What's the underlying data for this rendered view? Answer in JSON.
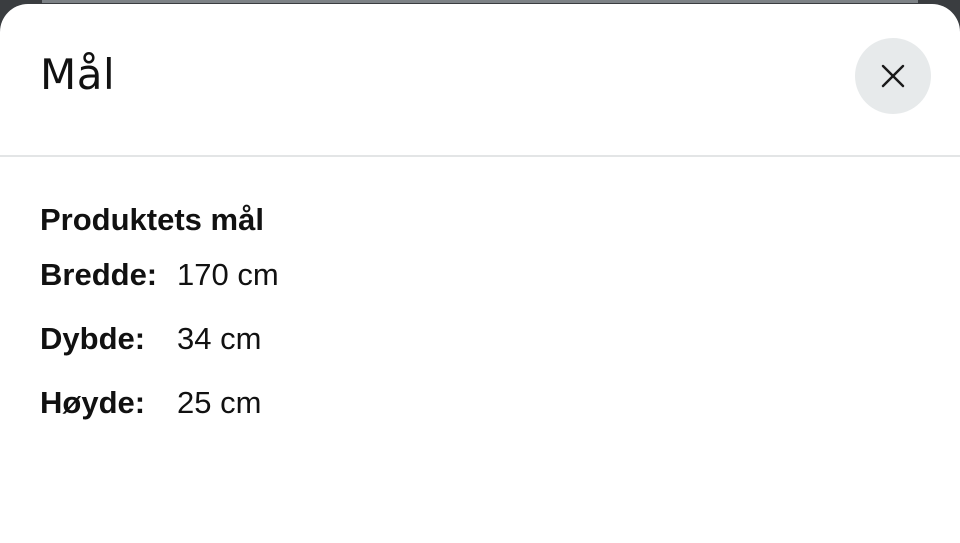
{
  "dialog": {
    "title": "Mål",
    "close_icon": "close-icon"
  },
  "dimensions": {
    "heading": "Produktets mål",
    "rows": [
      {
        "label": "Bredde:",
        "value": "170 cm"
      },
      {
        "label": "Dybde:",
        "value": "34 cm"
      },
      {
        "label": "Høyde:",
        "value": "25 cm"
      }
    ]
  },
  "colors": {
    "sheet_background": "#ffffff",
    "backdrop": "#3a3d40",
    "close_button_background": "#e7eaeb",
    "divider": "#e3e5e6",
    "text": "#111111"
  }
}
